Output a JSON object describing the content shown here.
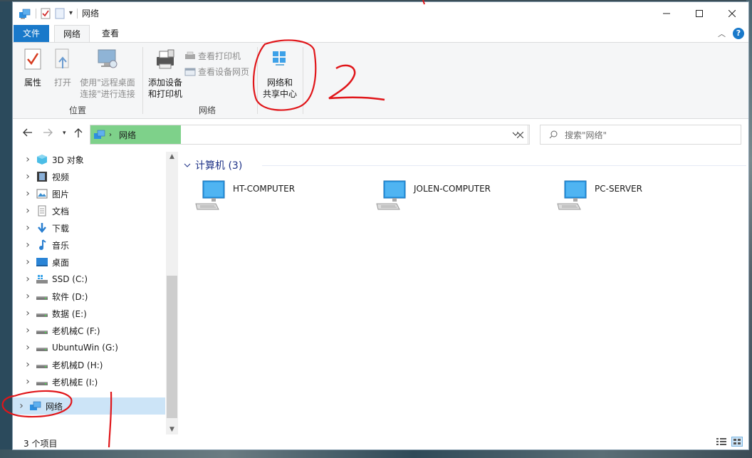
{
  "window": {
    "title": "网络"
  },
  "ribbon_tabs": {
    "file": "文件",
    "network": "网络",
    "view": "查看"
  },
  "ribbon": {
    "groups": {
      "location": "位置",
      "network": "网络"
    },
    "properties": "属性",
    "open": "打开",
    "rdp_line1": "使用\"远程桌面",
    "rdp_line2": "连接\"进行连接",
    "add_device_line1": "添加设备",
    "add_device_line2": "和打印机",
    "view_printers": "查看打印机",
    "view_device_web": "查看设备网页",
    "nsc_line1": "网络和",
    "nsc_line2": "共享中心"
  },
  "address": {
    "crumb": "网络",
    "search_placeholder": "搜索\"网络\""
  },
  "nav_tree": [
    {
      "label": "3D 对象",
      "icon": "3d-objects-icon"
    },
    {
      "label": "视频",
      "icon": "videos-icon"
    },
    {
      "label": "图片",
      "icon": "pictures-icon"
    },
    {
      "label": "文档",
      "icon": "documents-icon"
    },
    {
      "label": "下载",
      "icon": "downloads-icon"
    },
    {
      "label": "音乐",
      "icon": "music-icon"
    },
    {
      "label": "桌面",
      "icon": "desktop-icon"
    },
    {
      "label": "SSD (C:)",
      "icon": "system-drive-icon"
    },
    {
      "label": "软件 (D:)",
      "icon": "drive-icon"
    },
    {
      "label": "数据 (E:)",
      "icon": "drive-icon"
    },
    {
      "label": "老机械C (F:)",
      "icon": "drive-icon"
    },
    {
      "label": "UbuntuWin (G:)",
      "icon": "drive-icon"
    },
    {
      "label": "老机械D (H:)",
      "icon": "drive-icon"
    },
    {
      "label": "老机械E (I:)",
      "icon": "drive-icon"
    },
    {
      "label": "网络",
      "icon": "network-icon"
    }
  ],
  "content": {
    "group_header": "计算机 (3)",
    "computers": [
      "HT-COMPUTER",
      "JOLEN-COMPUTER",
      "PC-SERVER"
    ]
  },
  "status": {
    "item_count": "3 个项目"
  },
  "colors": {
    "accent": "#1979ca",
    "address_highlight": "#7ed18a",
    "selection": "#cce4f7",
    "annotation": "#e0161a"
  }
}
